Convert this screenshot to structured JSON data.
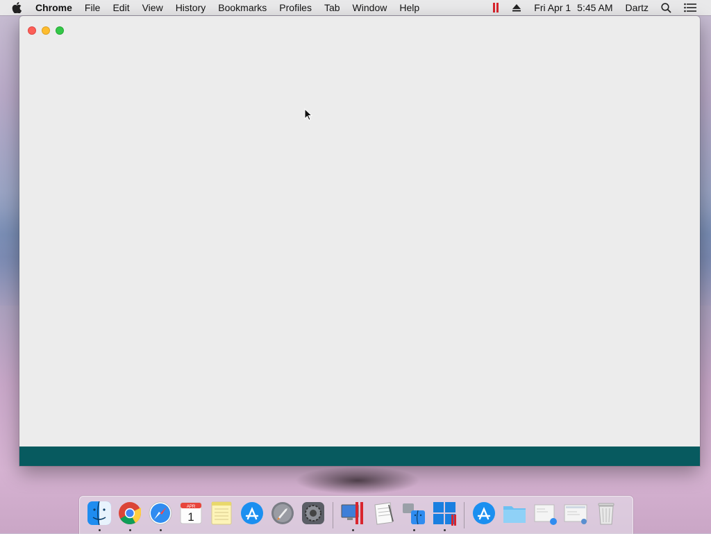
{
  "menubar": {
    "app_name": "Chrome",
    "menus": [
      "File",
      "Edit",
      "View",
      "History",
      "Bookmarks",
      "Profiles",
      "Tab",
      "Window",
      "Help"
    ],
    "status": {
      "date": "Fri Apr 1",
      "time": "5:45 AM",
      "user": "Dartz"
    },
    "icons": [
      "apple-icon",
      "parallels-icon",
      "eject-icon",
      "spotlight-search-icon",
      "notification-center-icon"
    ]
  },
  "window": {
    "title": "",
    "footer_color": "#075a5f",
    "controls": [
      "close",
      "minimize",
      "zoom"
    ]
  },
  "dock": {
    "apps": [
      {
        "name": "finder-icon",
        "running": true
      },
      {
        "name": "chrome-icon",
        "running": true
      },
      {
        "name": "safari-icon",
        "running": true
      },
      {
        "name": "calendar-icon",
        "running": false,
        "month": "APR",
        "day": "1"
      },
      {
        "name": "notes-icon",
        "running": false
      },
      {
        "name": "app-store-icon",
        "running": false
      },
      {
        "name": "launchpad-icon",
        "running": false
      },
      {
        "name": "system-preferences-icon",
        "running": false
      },
      {
        "name": "parallels-desktop-icon",
        "running": true
      },
      {
        "name": "textedit-icon",
        "running": false
      },
      {
        "name": "migration-assistant-icon",
        "running": true
      },
      {
        "name": "windows-vm-icon",
        "running": true
      },
      {
        "name": "app-store-downloads-icon",
        "running": false
      },
      {
        "name": "folder-icon",
        "running": false
      },
      {
        "name": "safari-document-icon",
        "running": false
      },
      {
        "name": "screenshot-document-icon",
        "running": false
      },
      {
        "name": "trash-icon",
        "running": false
      }
    ]
  },
  "colors": {
    "close": "#fc5f57",
    "minimize": "#fdbc2e",
    "zoom": "#33c748",
    "window_bg": "#ececec"
  }
}
